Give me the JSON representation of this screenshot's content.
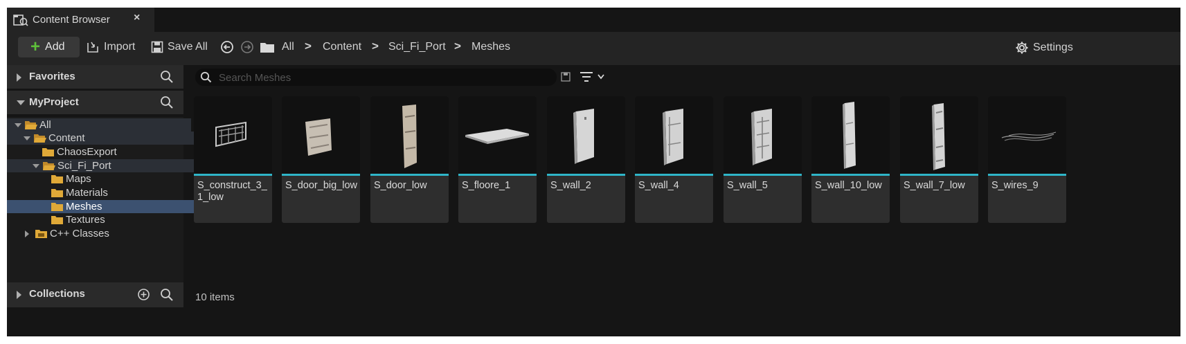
{
  "tab": {
    "title": "Content Browser",
    "close": "×"
  },
  "toolbar": {
    "add_label": "Add",
    "import_label": "Import",
    "save_all_label": "Save All",
    "settings_label": "Settings",
    "breadcrumbs": [
      "All",
      "Content",
      "Sci_Fi_Port",
      "Meshes"
    ],
    "separator": ">"
  },
  "left": {
    "favorites": "Favorites",
    "project": "MyProject",
    "collections": "Collections",
    "tree": [
      {
        "label": "All"
      },
      {
        "label": "Content"
      },
      {
        "label": "ChaosExport"
      },
      {
        "label": "Sci_Fi_Port"
      },
      {
        "label": "Maps"
      },
      {
        "label": "Materials"
      },
      {
        "label": "Meshes"
      },
      {
        "label": "Textures"
      },
      {
        "label": "C++ Classes"
      }
    ]
  },
  "search": {
    "placeholder": "Search Meshes",
    "value": ""
  },
  "assets": [
    {
      "name": "S_construct_3_1_low"
    },
    {
      "name": "S_door_big_low"
    },
    {
      "name": "S_door_low"
    },
    {
      "name": "S_floore_1"
    },
    {
      "name": "S_wall_2"
    },
    {
      "name": "S_wall_4"
    },
    {
      "name": "S_wall_5"
    },
    {
      "name": "S_wall_10_low"
    },
    {
      "name": "S_wall_7_low"
    },
    {
      "name": "S_wires_9"
    }
  ],
  "status": {
    "item_count": "10 items"
  },
  "colors": {
    "accent_bar": "#2fb5c8",
    "selection": "#3c5170",
    "add_plus": "#5ec03a",
    "folder": "#e0a938"
  }
}
